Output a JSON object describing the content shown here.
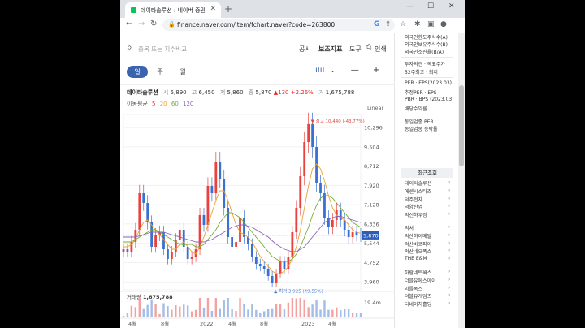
{
  "browser": {
    "tab_title": "데이타솔루션 : 네이버 증권",
    "new_tab": "+",
    "url": "finance.naver.com/item/fchart.naver?code=263800",
    "window_controls": [
      "—",
      "☐",
      "✕"
    ]
  },
  "search": {
    "placeholder": "종목 또는 지수비교"
  },
  "header_links": [
    "공시",
    "보조지표",
    "도구",
    "인쇄"
  ],
  "period_tabs": [
    "일",
    "주",
    "월"
  ],
  "active_period": "일",
  "quote": {
    "name": "데이타솔루션",
    "open_label": "시",
    "open": "5,890",
    "high_label": "고",
    "high": "6,450",
    "low_label": "저",
    "low": "5,860",
    "close_label": "종",
    "close": "5,870",
    "change": "▲130 +2.26%",
    "volume_label": "거",
    "volume": "1,675,788"
  },
  "moving_average": {
    "label": "이동평균",
    "periods": [
      "5",
      "20",
      "60",
      "120"
    ]
  },
  "scale_mode": "Linear",
  "chart_data": {
    "type": "line",
    "y_ticks": [
      "10,296",
      "9,504",
      "8,712",
      "7,920",
      "7,128",
      "6,336",
      "5,544",
      "4,752",
      "3,960"
    ],
    "y_tick_values": [
      10296,
      9504,
      8712,
      7920,
      7128,
      6336,
      5544,
      4752,
      3960
    ],
    "x_ticks": [
      "4월",
      "8월",
      "2022",
      "4월",
      "8월",
      "2023",
      "4월"
    ],
    "current_price_label": "5,870",
    "current_price": 5870,
    "max_annotation": "최고 10,440 (-43.77%)",
    "max_value": 10440,
    "min_annotation": "최저 3,925 (49.55%)",
    "min_value": 3925,
    "volume_title": "거래량",
    "volume_value": "1,675,788",
    "volume_axis_label": "19.4m",
    "close_series": [
      5300,
      5200,
      5600,
      6100,
      7600,
      7200,
      6400,
      5400,
      5900,
      6000,
      5300,
      4900,
      5200,
      5700,
      6100,
      5400,
      4900,
      5000,
      5300,
      6700,
      6300,
      7900,
      7600,
      8900,
      8200,
      7000,
      5800,
      5400,
      5600,
      6600,
      5800,
      5500,
      5000,
      4700,
      4600,
      4500,
      4200,
      3925,
      4300,
      4800,
      4500,
      5000,
      6000,
      7000,
      8300,
      9700,
      10440,
      9500,
      8000,
      7600,
      6600,
      6200,
      6500,
      6900,
      6500,
      6100,
      5800,
      6000,
      5900,
      5870
    ],
    "ma_series": [
      {
        "name": "20",
        "color": "#f0a030",
        "values": [
          5400,
          5400,
          5500,
          5700,
          6100,
          6400,
          6500,
          6300,
          6100,
          5900,
          5700,
          5500,
          5300,
          5300,
          5500,
          5600,
          5400,
          5200,
          5100,
          5400,
          5800,
          6300,
          6800,
          7300,
          7700,
          7700,
          7300,
          6800,
          6300,
          6000,
          5900,
          5800,
          5600,
          5300,
          5000,
          4800,
          4600,
          4400,
          4300,
          4300,
          4400,
          4600,
          4900,
          5400,
          6100,
          7000,
          7900,
          8600,
          8800,
          8600,
          8100,
          7500,
          7000,
          6700,
          6600,
          6500,
          6300,
          6100,
          6000,
          5950
        ]
      },
      {
        "name": "60",
        "color": "#77aa33",
        "values": [
          5600,
          5600,
          5600,
          5700,
          5800,
          5900,
          6000,
          6100,
          6100,
          6000,
          5900,
          5800,
          5700,
          5600,
          5500,
          5500,
          5500,
          5500,
          5400,
          5400,
          5500,
          5700,
          5900,
          6100,
          6400,
          6600,
          6800,
          6800,
          6700,
          6600,
          6400,
          6200,
          6000,
          5800,
          5600,
          5400,
          5200,
          5000,
          4900,
          4800,
          4800,
          4800,
          4900,
          5100,
          5400,
          5800,
          6200,
          6700,
          7100,
          7400,
          7500,
          7500,
          7400,
          7200,
          7000,
          6800,
          6600,
          6400,
          6300,
          6200
        ]
      },
      {
        "name": "120",
        "color": "#8866bb",
        "values": [
          5800,
          5800,
          5800,
          5800,
          5850,
          5900,
          5950,
          6000,
          6000,
          6000,
          6000,
          5950,
          5900,
          5850,
          5800,
          5750,
          5700,
          5650,
          5600,
          5600,
          5600,
          5650,
          5700,
          5800,
          5900,
          6000,
          6100,
          6200,
          6250,
          6300,
          6300,
          6250,
          6200,
          6100,
          6000,
          5900,
          5800,
          5650,
          5500,
          5400,
          5300,
          5250,
          5200,
          5200,
          5300,
          5400,
          5600,
          5800,
          6000,
          6200,
          6400,
          6500,
          6600,
          6650,
          6650,
          6600,
          6550,
          6500,
          6450,
          6400
        ]
      }
    ]
  },
  "sidebar": {
    "investor_lines": [
      "외국인한도주식수(A)",
      "외국인보유주식수(B)",
      "외국인소진율(B/A)"
    ],
    "opinion_lines": [
      "투자의견 · 목표주가",
      "52주최고 · 최저"
    ],
    "per_lines": [
      "PER · EPS(2023.03)",
      "추정PER · EPS",
      "PBR · BPS (2023.03)",
      "배당수익률"
    ],
    "industry_lines": [
      "동일업종 PER",
      "동일업종 등락률"
    ],
    "recent_title": "최근조회",
    "recent_items": [
      "데이타솔루션",
      "에센시스타즈",
      "덕주전자",
      "덕양산업",
      "럭신하우징",
      "럭셔",
      "럭산하이메탈",
      "럭산바코파이",
      "럭산네오폭스",
      "THE E&M",
      "하람네트웍스",
      "더블유에스아이",
      "리틀폭스",
      "더블유게임즈",
      "다네이처홀딩"
    ]
  }
}
